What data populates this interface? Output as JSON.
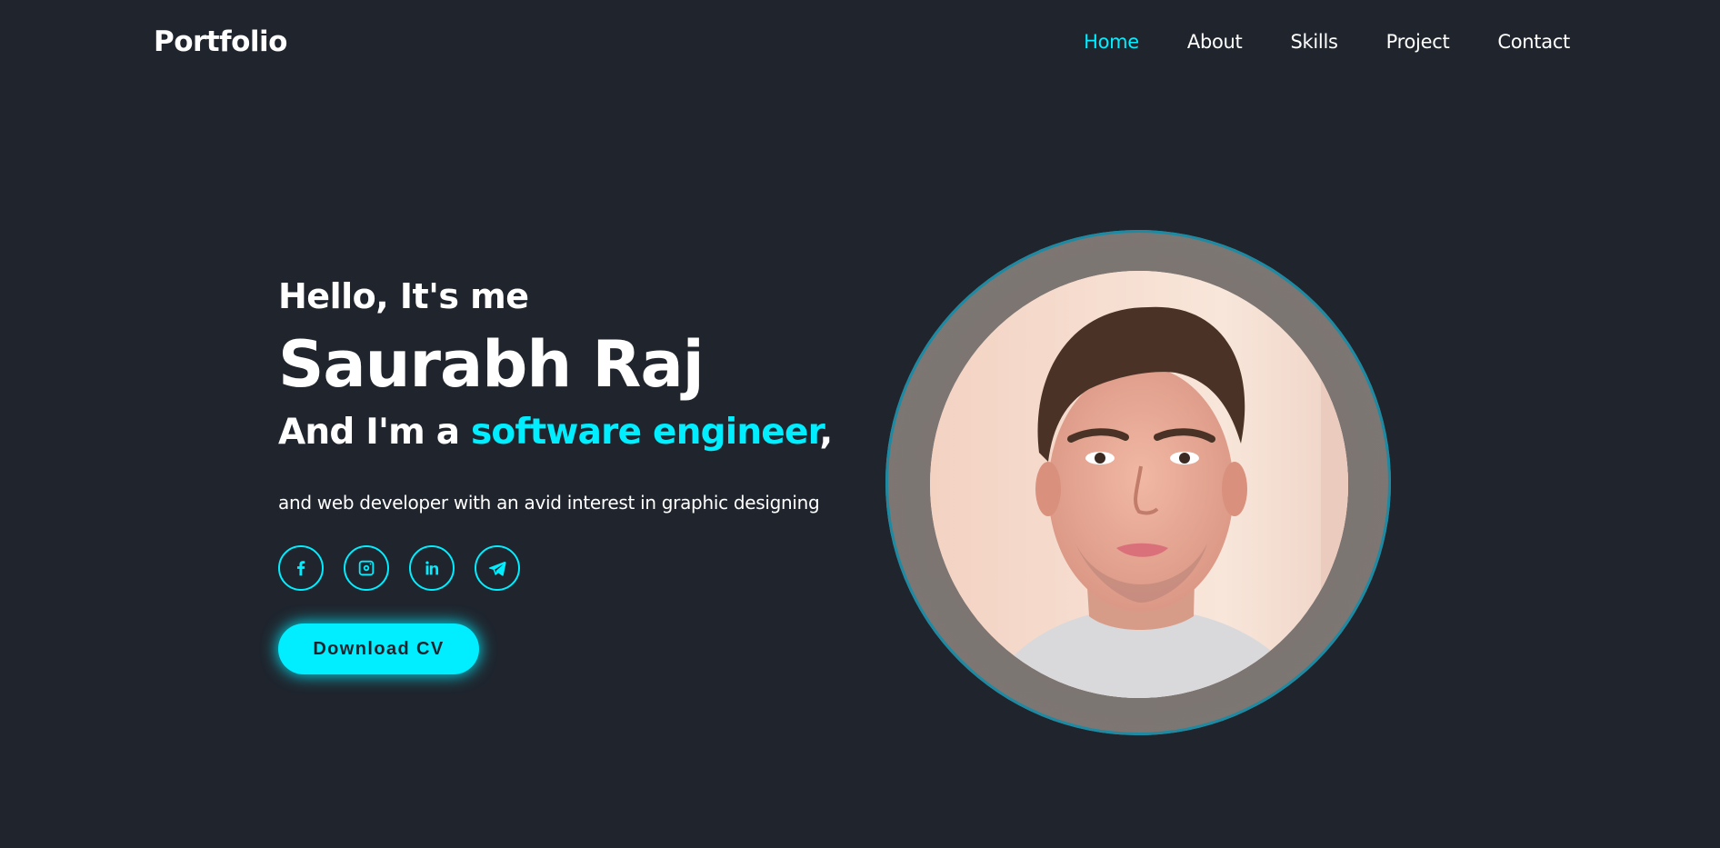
{
  "header": {
    "logo": "Portfolio",
    "nav": [
      {
        "label": "Home",
        "active": true
      },
      {
        "label": "About",
        "active": false
      },
      {
        "label": "Skills",
        "active": false
      },
      {
        "label": "Project",
        "active": false
      },
      {
        "label": "Contact",
        "active": false
      }
    ]
  },
  "hero": {
    "greeting": "Hello, It's me",
    "name": "Saurabh Raj",
    "role_prefix": "And I'm a",
    "role_highlight": "software engineer",
    "role_suffix": ",",
    "description": "and web developer with an avid interest in graphic designing",
    "social_icons": [
      {
        "name": "facebook-icon"
      },
      {
        "name": "instagram-icon"
      },
      {
        "name": "linkedin-icon"
      },
      {
        "name": "telegram-icon"
      }
    ],
    "cv_button": "Download CV"
  },
  "colors": {
    "background": "#1f242d",
    "accent": "#00eeff",
    "text": "#ffffff"
  }
}
